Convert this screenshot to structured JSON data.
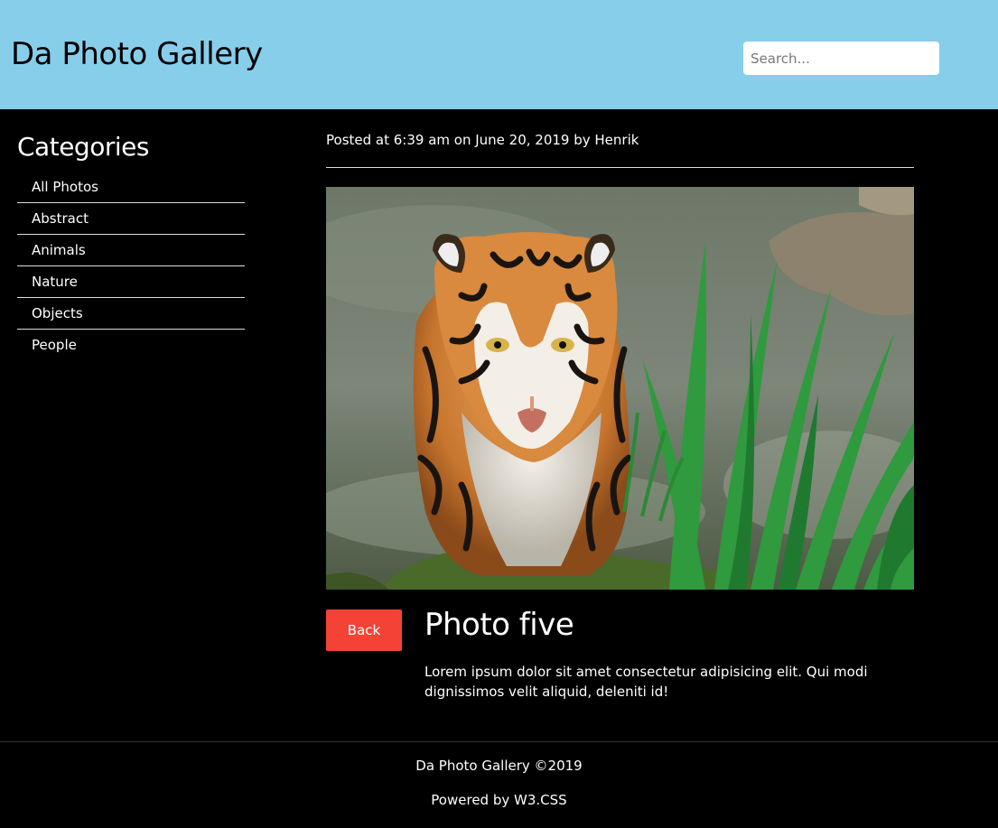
{
  "header": {
    "title": "Da Photo Gallery",
    "search_placeholder": "Search..."
  },
  "sidebar": {
    "heading": "Categories",
    "items": [
      {
        "label": "All Photos"
      },
      {
        "label": "Abstract"
      },
      {
        "label": "Animals"
      },
      {
        "label": "Nature"
      },
      {
        "label": "Objects"
      },
      {
        "label": "People"
      }
    ]
  },
  "post": {
    "meta": "Posted at 6:39 am on June 20, 2019 by Henrik",
    "photo_subject": "tiger-in-water",
    "back_label": "Back",
    "title": "Photo five",
    "description": "Lorem ipsum dolor sit amet consectetur adipisicing elit. Qui modi dignissimos velit aliquid, deleniti id!"
  },
  "footer": {
    "copyright": "Da Photo Gallery ©2019",
    "powered_prefix": "Powered by ",
    "powered_link": "W3.CSS"
  },
  "colors": {
    "header_bg": "#87ceeb",
    "page_bg": "#000000",
    "back_button": "#f44336"
  }
}
